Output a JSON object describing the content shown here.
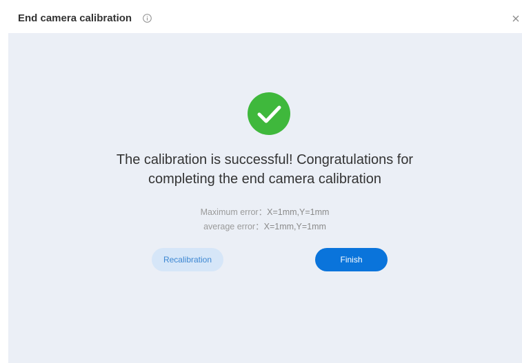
{
  "dialog": {
    "title": "End camera calibration",
    "info_icon": "info-circle-icon",
    "close_icon": "close-icon"
  },
  "result": {
    "status_icon": "check-circle-icon",
    "message_line1": "The calibration is successful! Congratulations for",
    "message_line2": "completing the end camera calibration",
    "max_error_label": "Maximum error：",
    "max_error_value": "X=1mm,Y=1mm",
    "avg_error_label": "average error：",
    "avg_error_value": "X=1mm,Y=1mm"
  },
  "actions": {
    "recalibration_label": "Recalibration",
    "finish_label": "Finish"
  },
  "colors": {
    "success": "#3fb83c",
    "primary": "#0a74db",
    "secondary_bg": "#d6e6f8",
    "panel_bg": "#ebeff6"
  }
}
